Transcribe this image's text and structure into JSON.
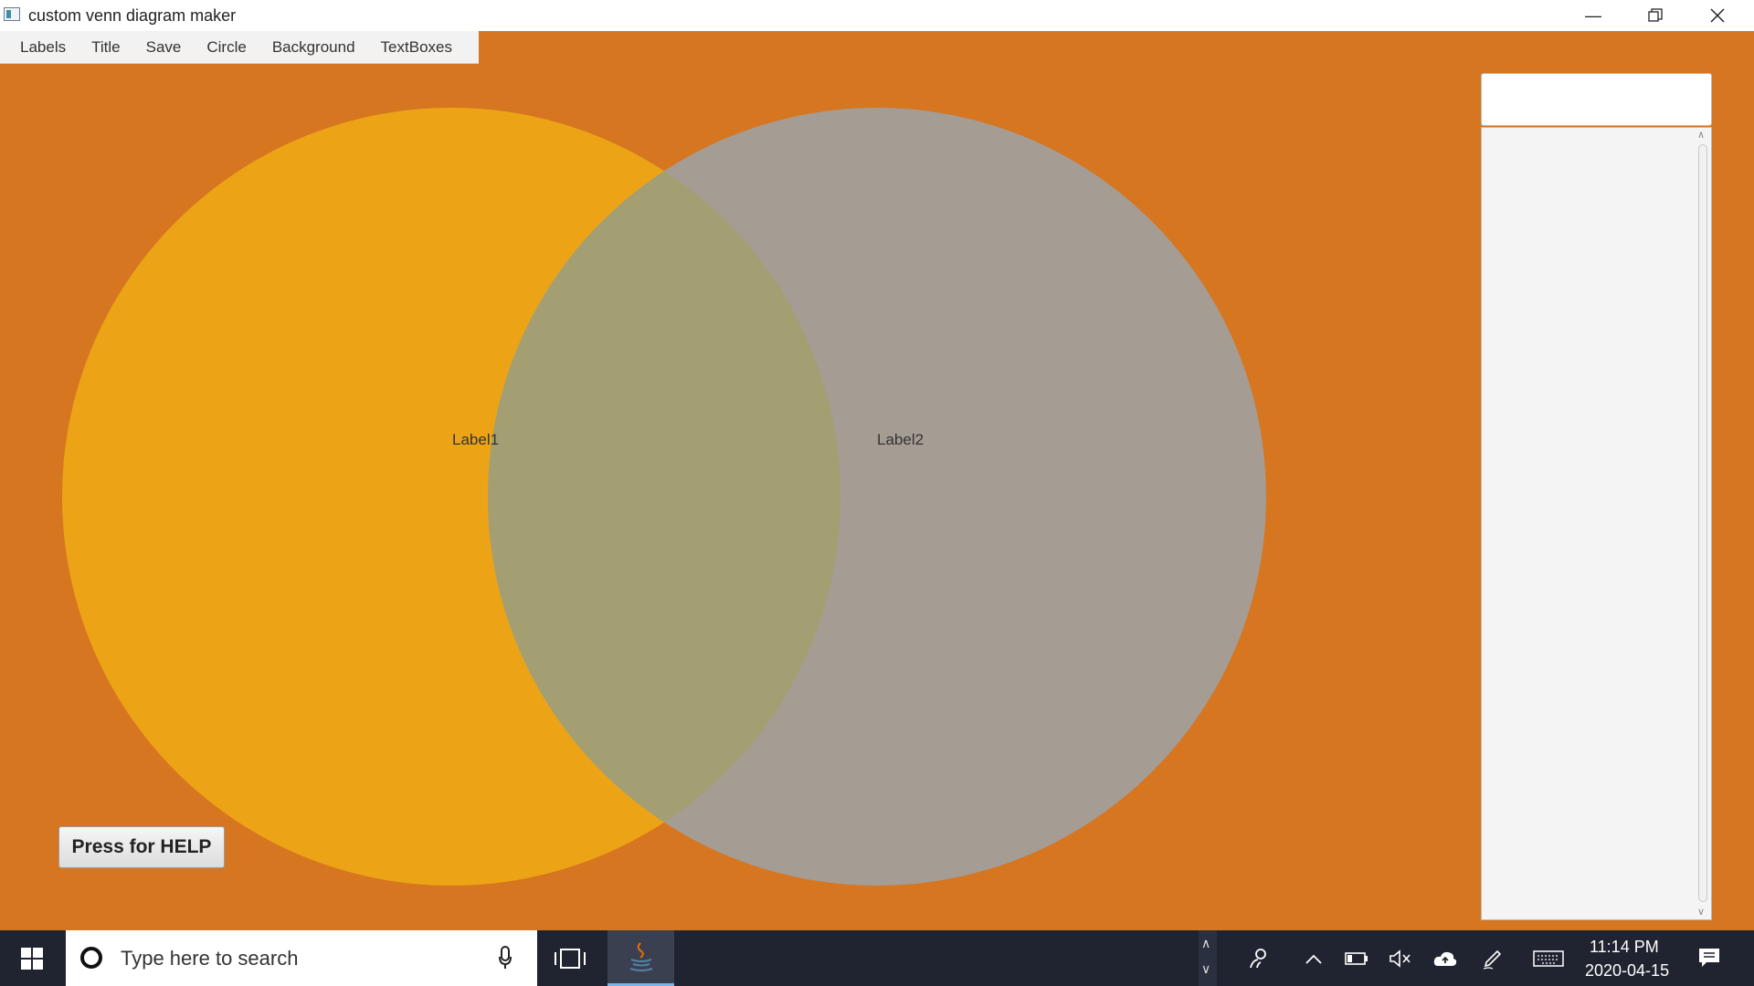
{
  "window": {
    "title": "custom venn diagram maker",
    "minimize_icon": "minimize-icon",
    "maximize_icon": "restore-icon",
    "close_icon": "close-icon"
  },
  "menu": {
    "items": [
      "Labels",
      "Title",
      "Save",
      "Circle",
      "Background",
      "TextBoxes"
    ]
  },
  "canvas": {
    "background_color": "#d67621",
    "circles": [
      {
        "label": "Label1",
        "color": "#eca416"
      },
      {
        "label": "Label2",
        "color": "#a59c94"
      }
    ],
    "overlap_color": "#a39f73",
    "help_button": "Press for HELP"
  },
  "side_panel": {
    "input_value": "",
    "list_items": []
  },
  "taskbar": {
    "search_placeholder": "Type here to search",
    "time": "11:14 PM",
    "date": "2020-04-15",
    "tray_icons": [
      "people-icon",
      "chevron-up-icon",
      "battery-icon",
      "volume-muted-icon",
      "cloud-upload-icon",
      "pen-icon",
      "keyboard-icon",
      "notification-icon"
    ]
  }
}
